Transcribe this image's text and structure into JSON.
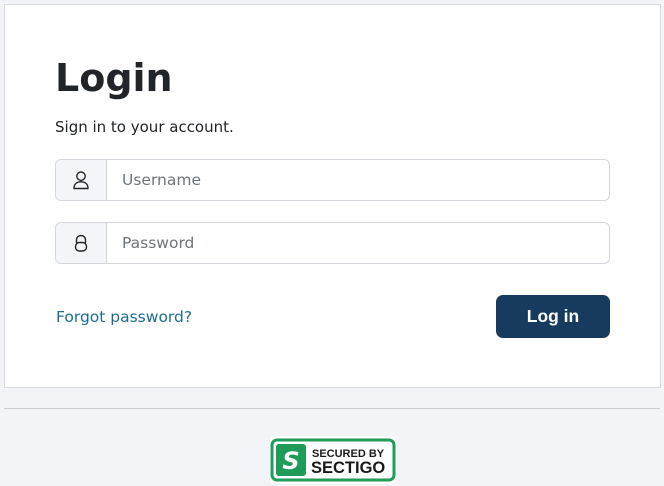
{
  "login": {
    "title": "Login",
    "subtitle": "Sign in to your account.",
    "username_placeholder": "Username",
    "password_placeholder": "Password",
    "forgot_link": "Forgot password?",
    "submit_label": "Log in"
  },
  "icons": {
    "username": "user-icon",
    "password": "lock-icon"
  },
  "badge": {
    "line1": "SECURED BY",
    "line2": "SECTIGO",
    "letter": "S"
  },
  "colors": {
    "primary_button": "#163b5e",
    "link": "#1d6d8c",
    "badge_green": "#1f9d58"
  }
}
